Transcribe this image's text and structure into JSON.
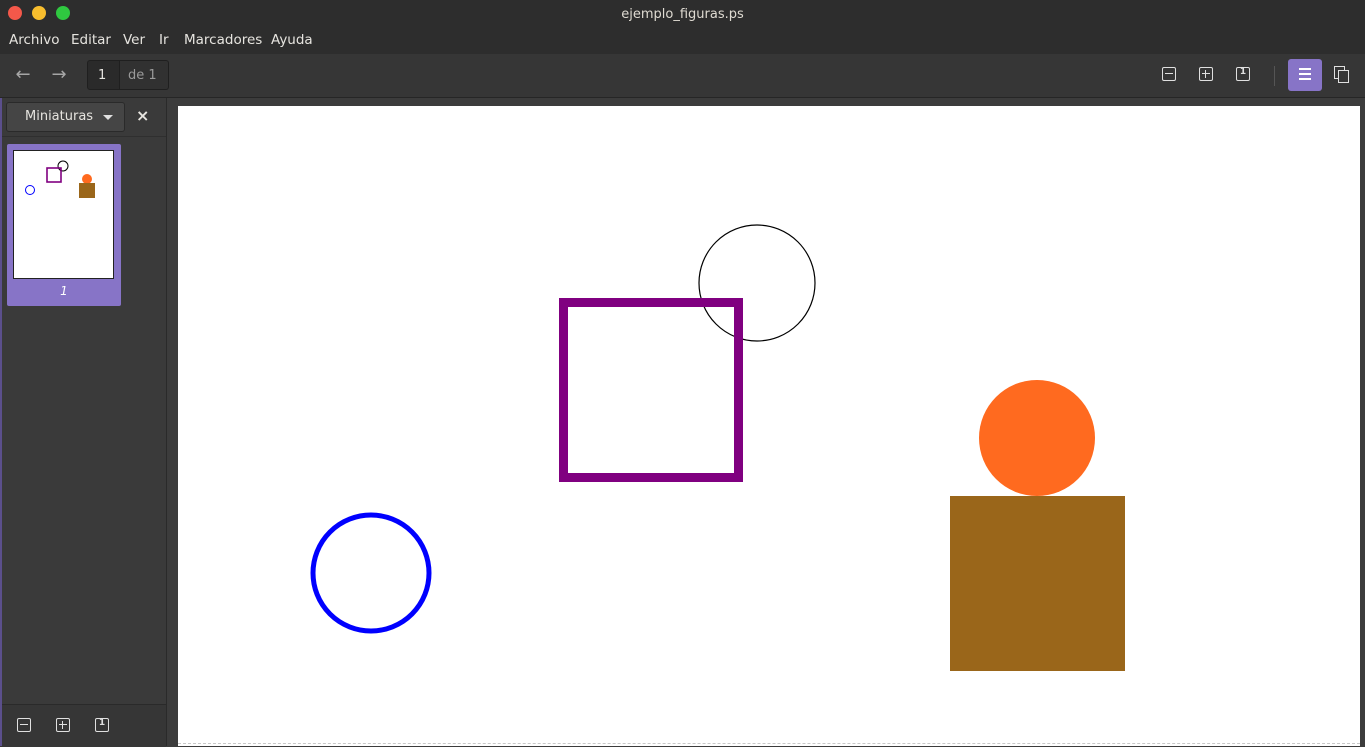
{
  "window": {
    "title": "ejemplo_figuras.ps"
  },
  "menu": {
    "items": [
      "Archivo",
      "Editar",
      "Ver",
      "Ir",
      "Marcadores",
      "Ayuda"
    ]
  },
  "toolbar": {
    "back_icon": "arrow-left-icon",
    "forward_icon": "arrow-right-icon",
    "page_current": "1",
    "page_total_label": "de 1",
    "zoom_out_icon": "zoom-out-icon",
    "zoom_in_icon": "zoom-in-icon",
    "zoom_fit_icon": "zoom-fit-page-icon",
    "continuous_icon": "continuous-view-icon",
    "dual_icon": "dual-page-icon",
    "active_color": "#8774c7"
  },
  "sidebar": {
    "mode_label": "Miniaturas",
    "close_glyph": "×",
    "thumbnails": [
      {
        "label": "1",
        "selected": true
      }
    ]
  },
  "document": {
    "shapes": [
      {
        "kind": "circle",
        "stroke": "#000000",
        "fill": "none"
      },
      {
        "kind": "square",
        "stroke": "#800080",
        "fill": "none"
      },
      {
        "kind": "circle",
        "stroke": "#0000ff",
        "fill": "none"
      },
      {
        "kind": "circle",
        "stroke": "none",
        "fill": "#ff6a1f"
      },
      {
        "kind": "square",
        "stroke": "none",
        "fill": "#9a661a"
      }
    ]
  }
}
